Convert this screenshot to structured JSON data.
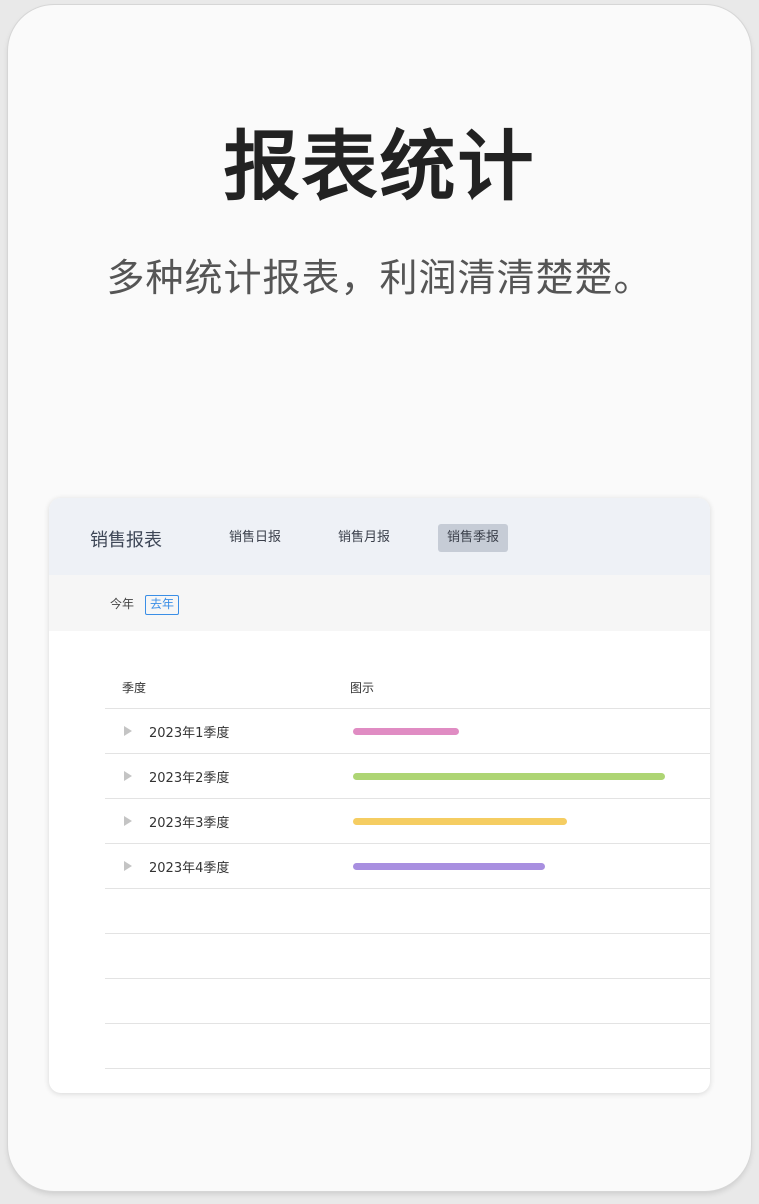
{
  "headline": "报表统计",
  "subline": "多种统计报表，利润清清楚楚。",
  "report": {
    "title": "销售报表",
    "tabs": [
      {
        "label": "销售日报",
        "active": false
      },
      {
        "label": "销售月报",
        "active": false
      },
      {
        "label": "销售季报",
        "active": true
      }
    ],
    "filters": [
      {
        "label": "今年",
        "active": false
      },
      {
        "label": "去年",
        "active": true
      }
    ],
    "columns": [
      "季度",
      "图示"
    ],
    "rows": [
      {
        "label": "2023年1季度",
        "fraction": 0.34,
        "color": "#e08cc3"
      },
      {
        "label": "2023年2季度",
        "fraction": 1.0,
        "color": "#aed574"
      },
      {
        "label": "2023年3季度",
        "fraction": 0.685,
        "color": "#f5cd62"
      },
      {
        "label": "2023年4季度",
        "fraction": 0.615,
        "color": "#a88fe0"
      }
    ],
    "empty_rows": 4
  }
}
